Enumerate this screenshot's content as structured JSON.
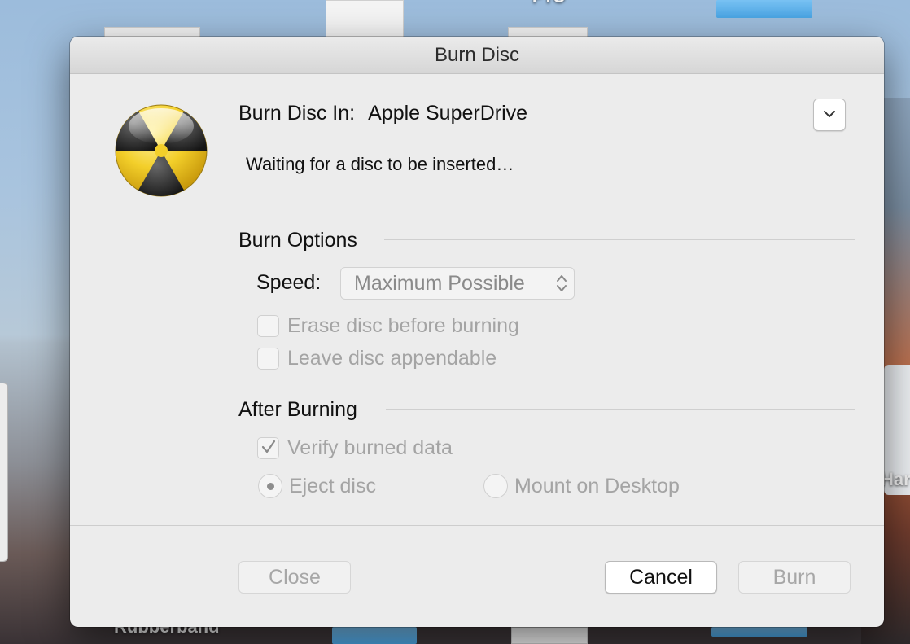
{
  "desktop": {
    "label_rubberband": "Rubberband",
    "label_partial_top": "PTO",
    "label_partial_right": "Har"
  },
  "dialog": {
    "title": "Burn Disc",
    "burn_in_label": "Burn Disc In:",
    "device_name": "Apple SuperDrive",
    "status": "Waiting for a disc to be inserted…",
    "burn_options": {
      "heading": "Burn Options",
      "speed_label": "Speed:",
      "speed_value": "Maximum Possible",
      "erase_label": "Erase disc before burning",
      "erase_checked": false,
      "appendable_label": "Leave disc appendable",
      "appendable_checked": false
    },
    "after_burning": {
      "heading": "After Burning",
      "verify_label": "Verify burned data",
      "verify_checked": true,
      "eject_label": "Eject disc",
      "eject_selected": true,
      "mount_label": "Mount on Desktop",
      "mount_selected": false
    },
    "buttons": {
      "close": "Close",
      "cancel": "Cancel",
      "burn": "Burn"
    },
    "icon_colors": {
      "yellow": "#f3cf2a",
      "black": "#2a2a2a"
    }
  }
}
